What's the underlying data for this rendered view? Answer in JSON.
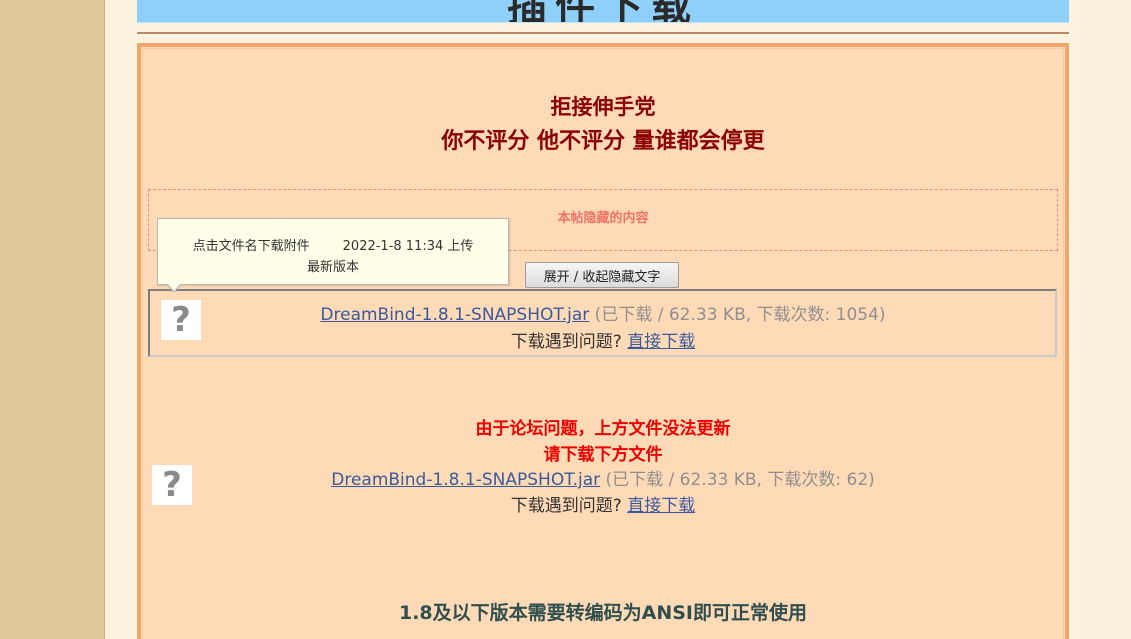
{
  "header": {
    "title": "插件下载"
  },
  "post": {
    "title_line1": "拒接伸手党",
    "title_line2": "你不评分 他不评分 量谁都会停更",
    "hidden_label": "本帖隐藏的内容",
    "toggle_button": "展开 / 收起隐藏文字"
  },
  "tooltip": {
    "line1": "点击文件名下载附件        2022-1-8 11:34 上传",
    "line2": "最新版本"
  },
  "attachments": [
    {
      "icon": "unknown-file-icon",
      "filename": "DreamBind-1.8.1-SNAPSHOT.jar",
      "meta": " (已下载 / 62.33 KB, 下载次数: 1054)",
      "help_text": "下载遇到问题? ",
      "direct_link": "直接下载"
    },
    {
      "icon": "unknown-file-icon",
      "filename": "DreamBind-1.8.1-SNAPSHOT.jar",
      "meta": " (已下载 / 62.33 KB, 下载次数: 62)",
      "help_text": "下载遇到问题? ",
      "direct_link": "直接下载"
    }
  ],
  "notice": {
    "line1": "由于论坛问题，上方文件没法更新",
    "line2": "请下载下方文件"
  },
  "bottom_note": "1.8及以下版本需要转编码为ANSI即可正常使用",
  "colors": {
    "banner": "#8fd0fb",
    "content_bg": "#ffdab7",
    "content_border": "#f0a56b",
    "title_red": "#8b0000",
    "notice_red": "#ee0000",
    "link_blue": "#3a5a9c"
  }
}
